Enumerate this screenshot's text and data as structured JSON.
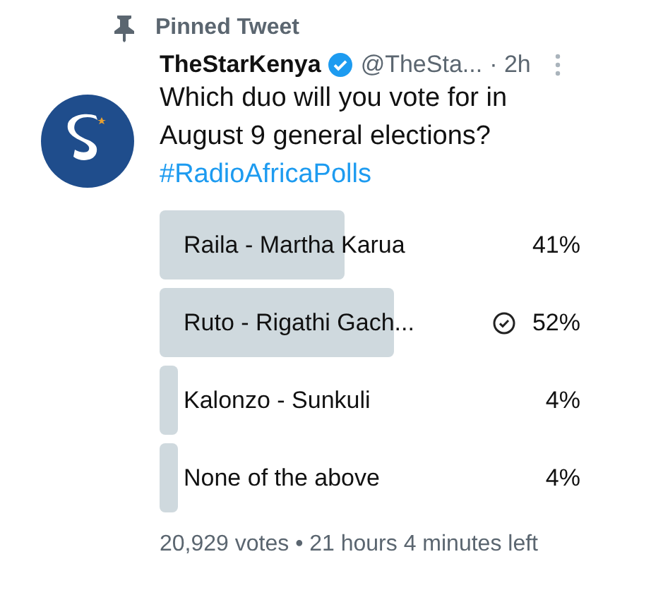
{
  "pinned_label": "Pinned Tweet",
  "tweet": {
    "name": "TheStarKenya",
    "verified": true,
    "handle": "@TheSta...",
    "time": "· 2h",
    "text": "Which duo will you vote for in August 9 general elections?",
    "hashtag": "#RadioAfricaPolls"
  },
  "poll": {
    "options": [
      {
        "label": "Raila - Martha Karua",
        "percent": "41%",
        "selected": false
      },
      {
        "label": "Ruto - Rigathi Gach...",
        "percent": "52%",
        "selected": true
      },
      {
        "label": "Kalonzo - Sunkuli",
        "percent": "4%",
        "selected": false
      },
      {
        "label": "None of the above",
        "percent": "4%",
        "selected": false
      }
    ],
    "footer": "20,929 votes • 21 hours 4 minutes left"
  }
}
